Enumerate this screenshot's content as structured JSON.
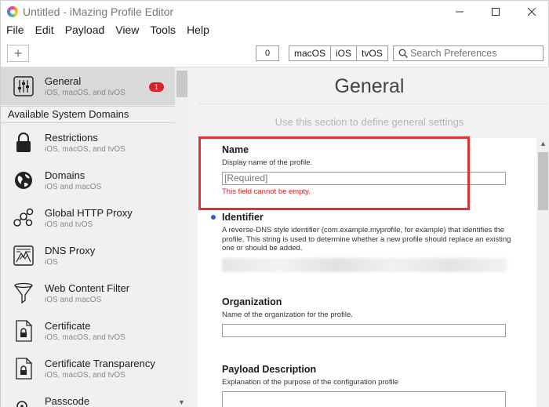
{
  "window": {
    "title": "Untitled - iMazing Profile Editor",
    "controls": {
      "minimize": "—",
      "maximize": "☐",
      "close": "✕"
    }
  },
  "menu": [
    "File",
    "Edit",
    "Payload",
    "View",
    "Tools",
    "Help"
  ],
  "toolbar": {
    "add_label": "+",
    "zero_label": "0",
    "platforms": [
      "macOS",
      "iOS",
      "tvOS"
    ],
    "search_placeholder": "Search Preferences"
  },
  "sidebar": {
    "section_label": "Available System Domains",
    "general": {
      "title": "General",
      "subtitle": "iOS, macOS, and tvOS",
      "badge": "1",
      "icon": "sliders-icon"
    },
    "items": [
      {
        "title": "Restrictions",
        "subtitle": "iOS, macOS, and tvOS",
        "icon": "lock-icon"
      },
      {
        "title": "Domains",
        "subtitle": "iOS and macOS",
        "icon": "globe-icon"
      },
      {
        "title": "Global HTTP Proxy",
        "subtitle": "iOS and tvOS",
        "icon": "network-icon"
      },
      {
        "title": "DNS Proxy",
        "subtitle": "iOS",
        "icon": "dns-icon"
      },
      {
        "title": "Web Content Filter",
        "subtitle": "iOS and macOS",
        "icon": "funnel-icon"
      },
      {
        "title": "Certificate",
        "subtitle": "iOS, macOS, and tvOS",
        "icon": "certificate-icon"
      },
      {
        "title": "Certificate Transparency",
        "subtitle": "iOS, macOS, and tvOS",
        "icon": "certificate-icon"
      },
      {
        "title": "Passcode",
        "subtitle": "",
        "icon": "passcode-icon"
      }
    ]
  },
  "main": {
    "title": "General",
    "description": "Use this section to define general settings",
    "fields": {
      "name": {
        "label": "Name",
        "description": "Display name of the profile.",
        "placeholder": "[Required]",
        "error": "This field cannot be empty."
      },
      "identifier": {
        "label": "Identifier",
        "description": "A reverse-DNS style identifier (com.example.myprofile, for example) that identifies the profile. This string is used to determine whether a new profile should replace an existing one or should be added."
      },
      "organization": {
        "label": "Organization",
        "description": "Name of the organization for the profile."
      },
      "payload_description": {
        "label": "Payload Description",
        "description": "Explanation of the purpose of the configuration profile"
      }
    }
  },
  "colors": {
    "highlight": "#e03232",
    "badge": "#d8232a",
    "required_dot": "#2a5bd7",
    "error": "#d02020"
  }
}
